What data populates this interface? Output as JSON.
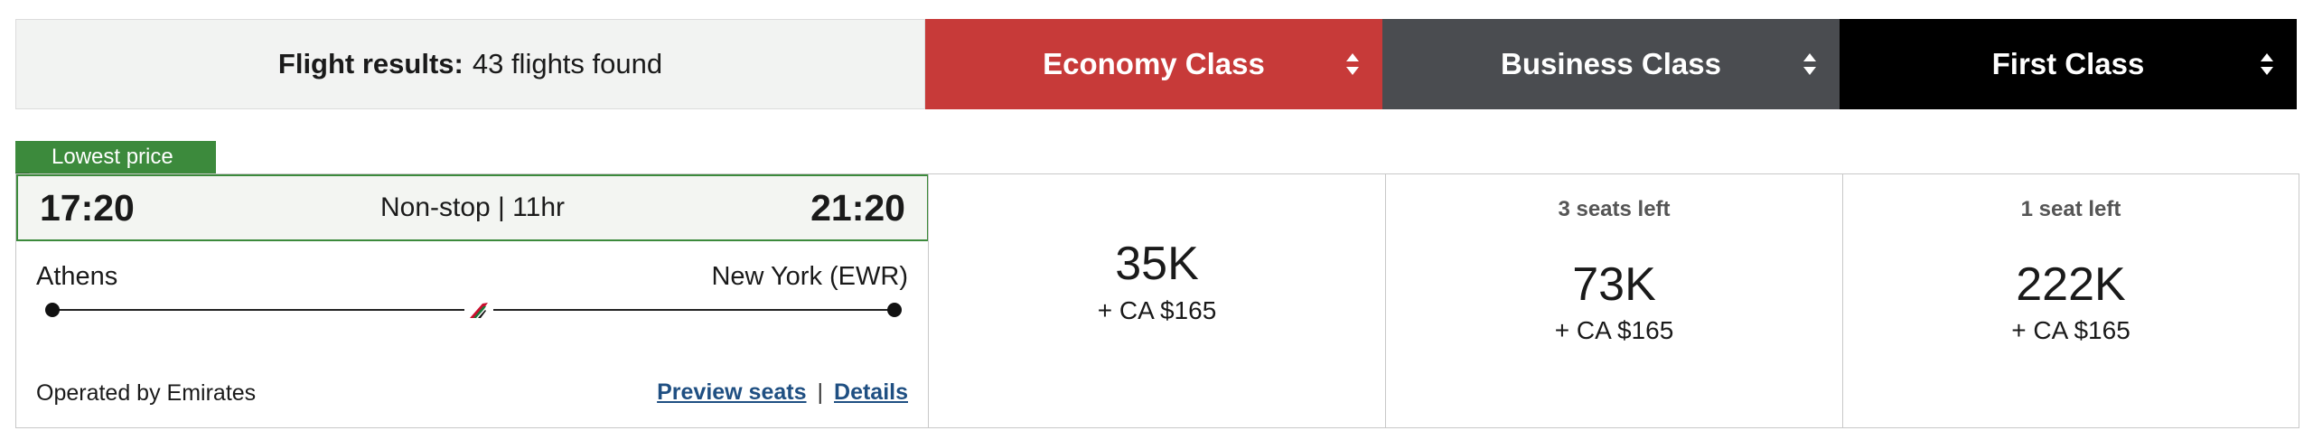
{
  "results": {
    "label": "Flight results:",
    "count_text": "43 flights found"
  },
  "classes": [
    {
      "name": "Economy Class",
      "color": "#c73a39"
    },
    {
      "name": "Business Class",
      "color": "#4a4c50"
    },
    {
      "name": "First Class",
      "color": "#000000"
    }
  ],
  "badge": {
    "label": "Lowest price",
    "color": "#3c8a3c"
  },
  "flight": {
    "depart_time": "17:20",
    "arrive_time": "21:20",
    "duration": "Non-stop | 11hr",
    "origin": "Athens",
    "destination": "New York (EWR)",
    "operator": "Operated by Emirates",
    "airline_icon": "emirates-tail-icon",
    "links": {
      "preview_seats": "Preview seats",
      "separator": "|",
      "details": "Details"
    },
    "fares": {
      "economy": {
        "points": "35K",
        "taxes": "+ CA $165"
      },
      "business": {
        "seats": "3 seats left",
        "points": "73K",
        "taxes": "+ CA $165"
      },
      "first": {
        "seats": "1 seat left",
        "points": "222K",
        "taxes": "+ CA $165"
      }
    }
  }
}
